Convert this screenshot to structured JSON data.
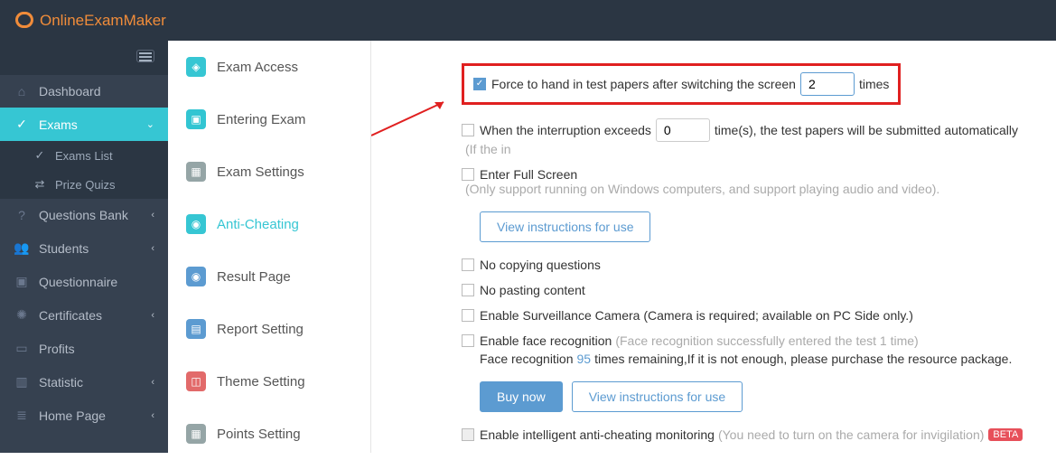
{
  "header": {
    "logo_text": "OnlineExamMaker"
  },
  "sidebar": {
    "items": [
      {
        "label": "Dashboard"
      },
      {
        "label": "Exams"
      },
      {
        "label": "Questions Bank"
      },
      {
        "label": "Students"
      },
      {
        "label": "Questionnaire"
      },
      {
        "label": "Certificates"
      },
      {
        "label": "Profits"
      },
      {
        "label": "Statistic"
      },
      {
        "label": "Home Page"
      }
    ],
    "subitems": [
      {
        "label": "Exams List"
      },
      {
        "label": "Prize Quizs"
      }
    ]
  },
  "midpanel": {
    "items": [
      {
        "label": "Exam Access"
      },
      {
        "label": "Entering Exam"
      },
      {
        "label": "Exam Settings"
      },
      {
        "label": "Anti-Cheating"
      },
      {
        "label": "Result Page"
      },
      {
        "label": "Report Setting"
      },
      {
        "label": "Theme Setting"
      },
      {
        "label": "Points Setting"
      }
    ]
  },
  "content": {
    "force_hand_in_pre": "Force to hand in test papers after switching the screen",
    "force_hand_in_value": "2",
    "force_hand_in_post": "times",
    "interruption_pre": "When the interruption exceeds",
    "interruption_value": "0",
    "interruption_post": "time(s), the test papers will be submitted automatically",
    "interruption_hint": "(If the in",
    "full_screen_label": "Enter Full Screen",
    "full_screen_hint": "(Only support running on Windows computers, and support playing audio and video).",
    "view_instructions": "View instructions for use",
    "no_copy": "No copying questions",
    "no_paste": "No pasting content",
    "surveillance": "Enable Surveillance Camera (Camera is required;  available on PC Side only.)",
    "face_rec_label": "Enable face recognition",
    "face_rec_hint": "(Face recognition successfully entered the test 1 time)",
    "face_rec_remaining_pre": "Face recognition ",
    "face_rec_remaining_count": "95",
    "face_rec_remaining_post": " times remaining,If it is not enough, please purchase the resource package.",
    "buy_now": "Buy now",
    "view_instructions2": "View instructions for use",
    "intelligent_label": "Enable intelligent anti-cheating monitoring",
    "intelligent_hint": "(You need to turn on the camera for invigilation)",
    "beta": "BETA"
  }
}
